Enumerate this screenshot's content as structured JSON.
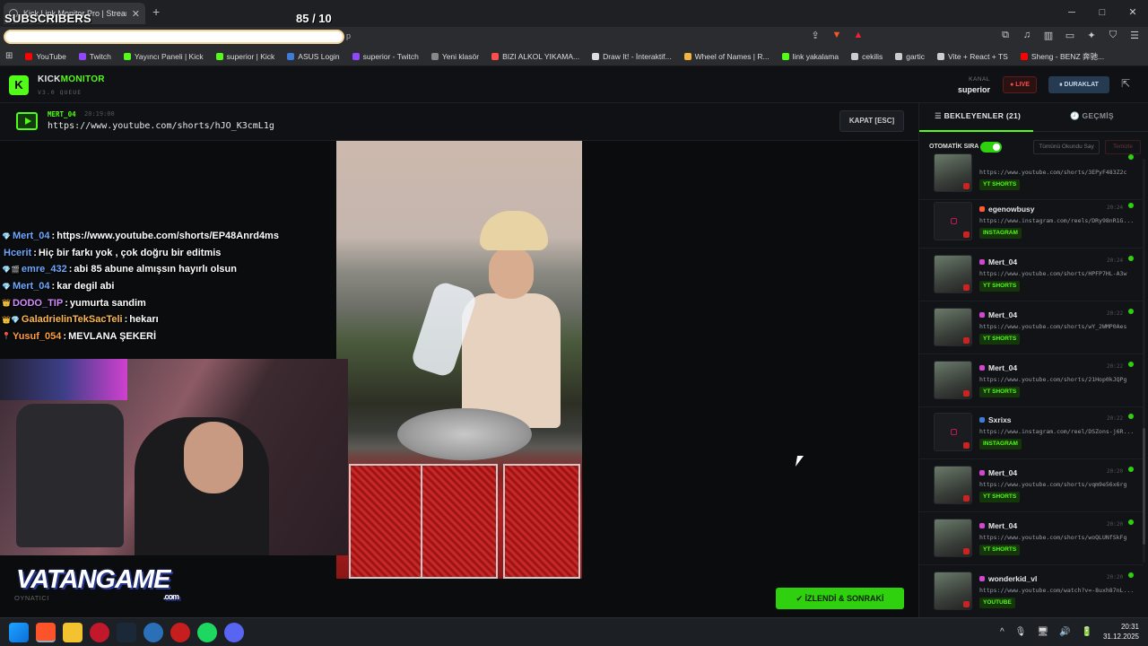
{
  "browser": {
    "tab_title": "Kick Link Monitor Pro | Stream",
    "new_tab": "+",
    "address_tail": "p",
    "window_controls": [
      "─",
      "□",
      "✕"
    ]
  },
  "overlay": {
    "subscribers_label": "SUBSCRIBERS",
    "subscribers_count": "85  / 10"
  },
  "bookmarks": [
    {
      "label": "YouTube",
      "color": "#ff0000"
    },
    {
      "label": "Twitch",
      "color": "#9146ff"
    },
    {
      "label": "Yayıncı Paneli | Kick",
      "color": "#53fc18"
    },
    {
      "label": "superior | Kick",
      "color": "#53fc18"
    },
    {
      "label": "ASUS Login",
      "color": "#3f7bd8"
    },
    {
      "label": "superior - Twitch",
      "color": "#9146ff"
    },
    {
      "label": "Yeni klasör",
      "color": "#888888"
    },
    {
      "label": "BIZI ALKOL YIKAMA...",
      "color": "#ff4d4d"
    },
    {
      "label": "Draw It! - İnteraktif...",
      "color": "#dddddd"
    },
    {
      "label": "Wheel of Names | R...",
      "color": "#f2b43a"
    },
    {
      "label": "link yakalama",
      "color": "#53fc18"
    },
    {
      "label": "cekilis",
      "color": "#cccccc"
    },
    {
      "label": "gartic",
      "color": "#cccccc"
    },
    {
      "label": "Vite + React + TS",
      "color": "#cccccc"
    },
    {
      "label": "Sheng - BENZ 奔驰...",
      "color": "#ff0000"
    }
  ],
  "app": {
    "logo": "K",
    "name_part1": "KICK",
    "name_part2": "MONITOR",
    "version": "V3.0 QUEUE",
    "channel_label": "KANAL",
    "channel_name": "superior",
    "live_label": "● LIVE",
    "pause_label": "⏸ DURAKLAT"
  },
  "now_playing": {
    "user": "MERT_04",
    "time": "20:19:00",
    "url": "https://www.youtube.com/shorts/hJO_K3cmL1g",
    "close_label": "KAPAT [ESC]"
  },
  "chat": [
    {
      "badge": "💎",
      "user": "Mert_04",
      "user_color": "#6fa8ff",
      "message": "https://www.youtube.com/shorts/EP48Anrd4ms"
    },
    {
      "badge": "",
      "user": "Hcerit",
      "user_color": "#6fa8ff",
      "message": "Hiç bir farkı yok , çok doğru bir editmis"
    },
    {
      "badge": "💎🎬",
      "user": "emre_432",
      "user_color": "#6fa8ff",
      "message": "abi 85 abune almışsın hayırlı olsun"
    },
    {
      "badge": "💎",
      "user": "Mert_04",
      "user_color": "#6fa8ff",
      "message": "kar degil abi"
    },
    {
      "badge": "👑",
      "user": "DODO_TIP",
      "user_color": "#d48cff",
      "message": "yumurta sandim"
    },
    {
      "badge": "👑💎",
      "user": "GaladrielinTekSacTeli",
      "user_color": "#ffb84d",
      "message": "hekarı"
    },
    {
      "badge": "📍",
      "user": "Yusuf_054",
      "user_color": "#ff9f43",
      "message": "MEVLANA ŞEKERİ"
    }
  ],
  "stage": {
    "brand_overlay": "VATANGAME",
    "brand_suffix": ".com",
    "player_label": "OYNATICI",
    "next_label": "✔ İZLENDİ & SONRAKİ"
  },
  "panel": {
    "tab_queue": "☰  BEKLEYENLER (21)",
    "tab_history": "🕘  GEÇMİŞ",
    "auto_label": "OTOMATİK SIRA",
    "mark_all_label": "Tümünü Okundu Say",
    "clear_label": "Temizle",
    "items": [
      {
        "user": "",
        "url": "https://www.youtube.com/shorts/3EPyF483Z2c",
        "time": "",
        "tag": "YT SHORTS",
        "thumb": "img",
        "dot": "#53fc18"
      },
      {
        "user": "egenowbusy",
        "url": "https://www.instagram.com/reels/DRy98nR1G...",
        "time": "20:24",
        "tag": "INSTAGRAM",
        "thumb": "ig",
        "dot": "#ff5a36"
      },
      {
        "user": "Mert_04",
        "url": "https://www.youtube.com/shorts/HPFP7HL-A3w",
        "time": "20:24",
        "tag": "YT SHORTS",
        "thumb": "img",
        "dot": "#d048d0"
      },
      {
        "user": "Mert_04",
        "url": "https://www.youtube.com/shorts/wY_2WMP0Aes",
        "time": "20:22",
        "tag": "YT SHORTS",
        "thumb": "img",
        "dot": "#d048d0"
      },
      {
        "user": "Mert_04",
        "url": "https://www.youtube.com/shorts/21Hop0kJQPg",
        "time": "20:22",
        "tag": "YT SHORTS",
        "thumb": "img",
        "dot": "#d048d0"
      },
      {
        "user": "Sxrixs",
        "url": "https://www.instagram.com/reel/DSZons-j6R...",
        "time": "20:22",
        "tag": "INSTAGRAM",
        "thumb": "ig",
        "dot": "#3f7bd8"
      },
      {
        "user": "Mert_04",
        "url": "https://www.youtube.com/shorts/vqm9e56x6rg",
        "time": "20:20",
        "tag": "YT SHORTS",
        "thumb": "img",
        "dot": "#d048d0"
      },
      {
        "user": "Mert_04",
        "url": "https://www.youtube.com/shorts/woQLUNfSkFg",
        "time": "20:20",
        "tag": "YT SHORTS",
        "thumb": "img",
        "dot": "#d048d0"
      },
      {
        "user": "wonderkid_vl",
        "url": "https://www.youtube.com/watch?v=-8uxh87nL...",
        "time": "20:20",
        "tag": "YOUTUBE",
        "thumb": "img",
        "dot": "#d048d0"
      }
    ]
  },
  "taskbar": {
    "time": "20:31",
    "date": "31.12.2025",
    "tray": [
      "^",
      "🎙",
      "🖥",
      "🔊",
      "🔋"
    ]
  }
}
